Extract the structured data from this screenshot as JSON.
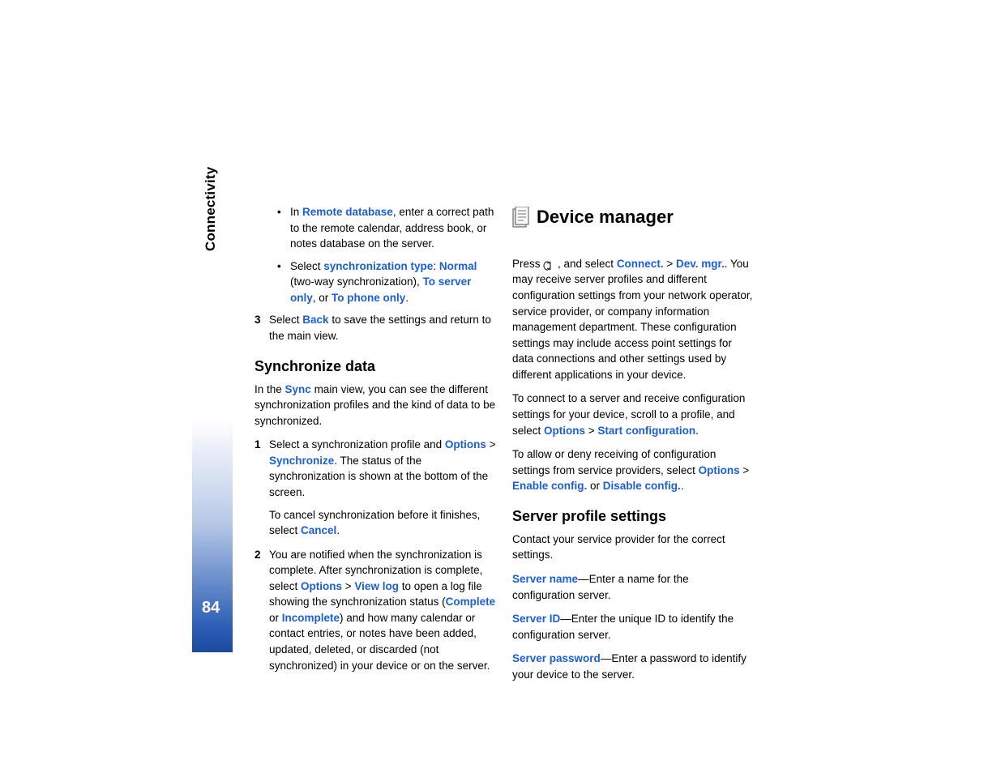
{
  "sidebar": {
    "section": "Connectivity",
    "page": "84"
  },
  "left": {
    "bullets": [
      {
        "pre": "In ",
        "l1": "Remote database",
        "post1": ", enter a correct path to the remote calendar, address book, or notes database on the server."
      },
      {
        "pre": "Select ",
        "l1": "synchronization type",
        "mid1": ": ",
        "l2": "Normal",
        "mid2": " (two-way synchronization), ",
        "l3": "To server only",
        "mid3": ", or ",
        "l4": "To phone only",
        "post": "."
      }
    ],
    "step3": {
      "num": "3",
      "pre": "Select ",
      "l1": "Back",
      "post": " to save the settings and return to the main view."
    },
    "h2": "Synchronize data",
    "intro": {
      "pre": "In the ",
      "l1": "Sync",
      "post": " main view, you can see the different synchronization profiles and the kind of data to be synchronized."
    },
    "step1": {
      "num": "1",
      "pre": "Select a synchronization profile and ",
      "l1": "Options",
      "mid1": " > ",
      "l2": "Synchronize",
      "post1": ". The status of the synchronization is shown at the bottom of the screen.",
      "sub_pre": "To cancel synchronization before it finishes, select ",
      "sub_l1": "Cancel",
      "sub_post": "."
    },
    "step2": {
      "num": "2",
      "pre": "You are notified when the synchronization is complete. After synchronization is complete, select ",
      "l1": "Options",
      "mid1": " > ",
      "l2": "View log",
      "mid2": " to open a log file showing the synchronization status (",
      "l3": "Complete",
      "mid3": " or ",
      "l4": "Incomplete",
      "post": ") and how many calendar or contact entries, or notes have been added, updated, deleted, or discarded (not synchronized) in your device or on the server."
    }
  },
  "right": {
    "h1": "Device manager",
    "p1": {
      "pre": "Press ",
      "mid1": " , and select ",
      "l1": "Connect.",
      "mid2": " > ",
      "l2": "Dev. mgr.",
      "post": ". You may receive server profiles and different configuration settings from your network operator, service provider, or company information management department. These configuration settings may include access point settings for data connections and other settings used by different applications in your device."
    },
    "p2": {
      "pre": "To connect to a server and receive configuration settings for your device, scroll to a profile, and select ",
      "l1": "Options",
      "mid1": " > ",
      "l2": "Start configuration",
      "post": "."
    },
    "p3": {
      "pre": "To allow or deny receiving of configuration settings from service providers, select ",
      "l1": "Options",
      "mid1": " > ",
      "l2": "Enable config.",
      "mid2": " or ",
      "l3": "Disable config.",
      "post": "."
    },
    "h2": "Server profile settings",
    "p4": "Contact your service provider for the correct settings.",
    "p5": {
      "l1": "Server name",
      "post": "—Enter a name for the configuration server."
    },
    "p6": {
      "l1": "Server ID",
      "post": "—Enter the unique ID to identify the configuration server."
    },
    "p7": {
      "l1": "Server password",
      "post": "—Enter a password to identify your device to the server."
    }
  }
}
